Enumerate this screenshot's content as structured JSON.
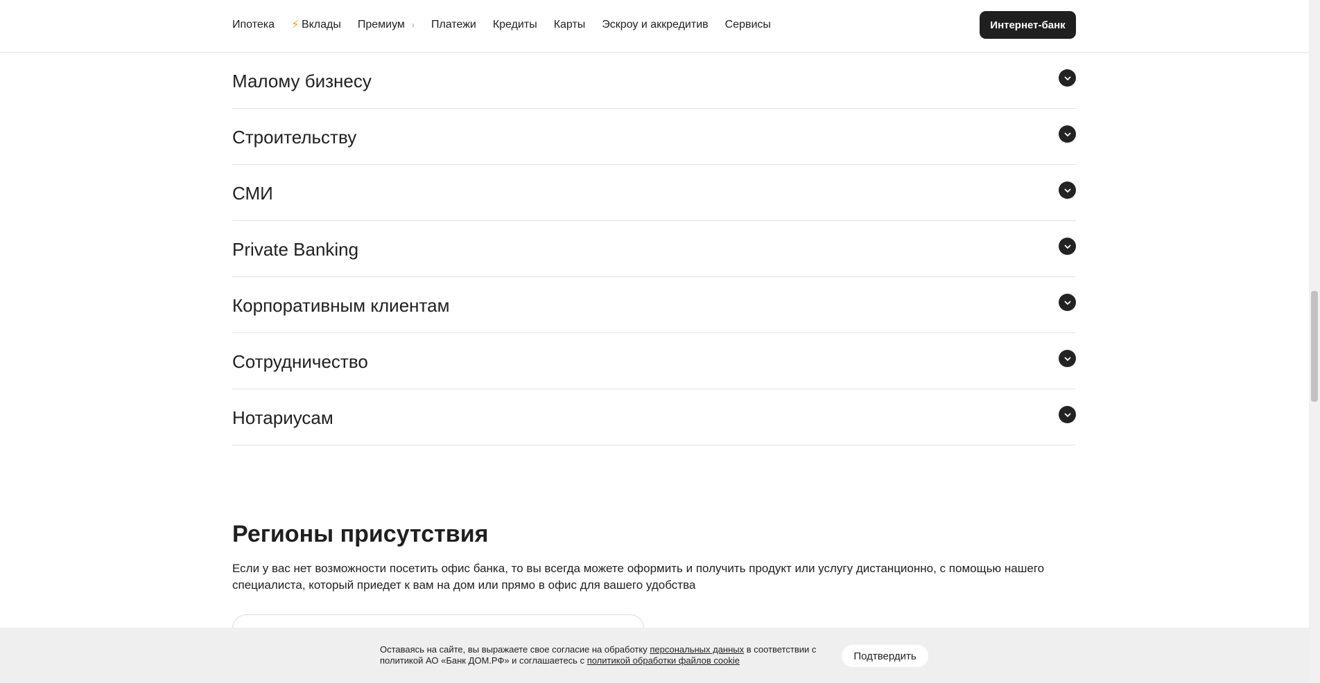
{
  "header": {
    "nav": [
      {
        "label": "Ипотека",
        "icon": null,
        "has_arrow": false
      },
      {
        "label": "Вклады",
        "icon": "lightning-icon",
        "has_arrow": false
      },
      {
        "label": "Премиум",
        "icon": null,
        "has_arrow": true
      },
      {
        "label": "Платежи",
        "icon": null,
        "has_arrow": false
      },
      {
        "label": "Кредиты",
        "icon": null,
        "has_arrow": false
      },
      {
        "label": "Карты",
        "icon": null,
        "has_arrow": false
      },
      {
        "label": "Эскроу и аккредитив",
        "icon": null,
        "has_arrow": false
      },
      {
        "label": "Сервисы",
        "icon": null,
        "has_arrow": false
      }
    ],
    "internet_bank_label": "Интернет-банк"
  },
  "accordion": [
    {
      "title": "Малому бизнесу"
    },
    {
      "title": "Строительству"
    },
    {
      "title": "СМИ"
    },
    {
      "title": "Private Banking"
    },
    {
      "title": "Корпоративным клиентам"
    },
    {
      "title": "Сотрудничество"
    },
    {
      "title": "Нотариусам"
    }
  ],
  "regions": {
    "title": "Регионы присутствия",
    "text": "Если у вас нет возможности посетить офис банка, то вы всегда можете оформить и получить продукт или услугу дистанционно, с помощью нашего специалиста, который приедет к вам на дом или прямо в офис для вашего удобства"
  },
  "cookie": {
    "text_1": "Оставаясь на сайте, вы выражаете свое согласие на обработку ",
    "link_1": "персональных данных",
    "text_2": " в соответствии с политикой АО «Банк ДОМ.РФ» и соглашаетесь с ",
    "link_2": "политикой обработки файлов cookie",
    "confirm_label": "Подтвердить"
  },
  "colors": {
    "accent_dark": "#1f1f1f",
    "bolt": "#f5a623",
    "cookie_bg": "#efefef"
  }
}
